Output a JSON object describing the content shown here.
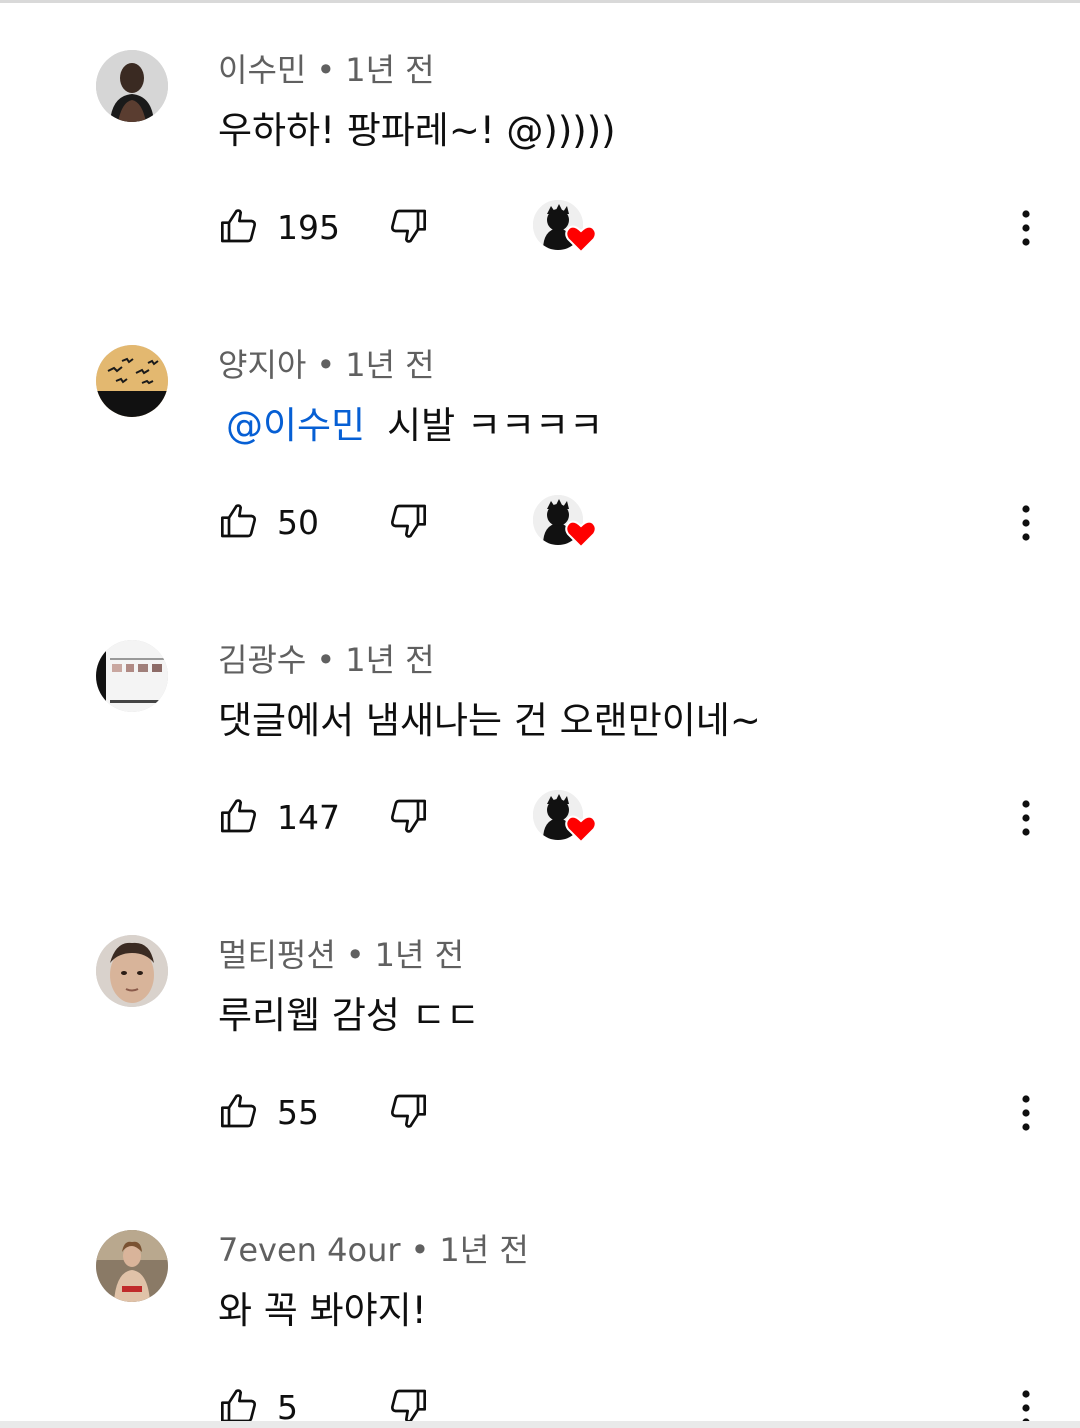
{
  "comments": [
    {
      "author": "이수민",
      "time": "1년 전",
      "mention": "",
      "text": "우하하! 팡파레~! @)))))",
      "likes": "195",
      "creator_hearted": true,
      "avatar_icon": "man-tank-top-avatar"
    },
    {
      "author": "양지아",
      "time": "1년 전",
      "mention": "@이수민",
      "text": "시발 ㅋㅋㅋㅋ",
      "likes": "50",
      "creator_hearted": true,
      "avatar_icon": "birds-silhouette-avatar"
    },
    {
      "author": "김광수",
      "time": "1년 전",
      "mention": "",
      "text": "댓글에서 냄새나는 건 오랜만이네~",
      "likes": "147",
      "creator_hearted": true,
      "avatar_icon": "screenshot-avatar"
    },
    {
      "author": "멀티펑션",
      "time": "1년 전",
      "mention": "",
      "text": "루리웹 감성 ㄷㄷ",
      "likes": "55",
      "creator_hearted": false,
      "avatar_icon": "face-avatar"
    },
    {
      "author": "7even 4our",
      "time": "1년 전",
      "mention": "",
      "text": "와 꼭 봐야지!",
      "likes": "5",
      "creator_hearted": false,
      "avatar_icon": "person-photo-avatar"
    }
  ],
  "meta_separator": "•",
  "colors": {
    "mention": "#065fd4",
    "meta_text": "#606060",
    "heart": "#ff0000"
  }
}
